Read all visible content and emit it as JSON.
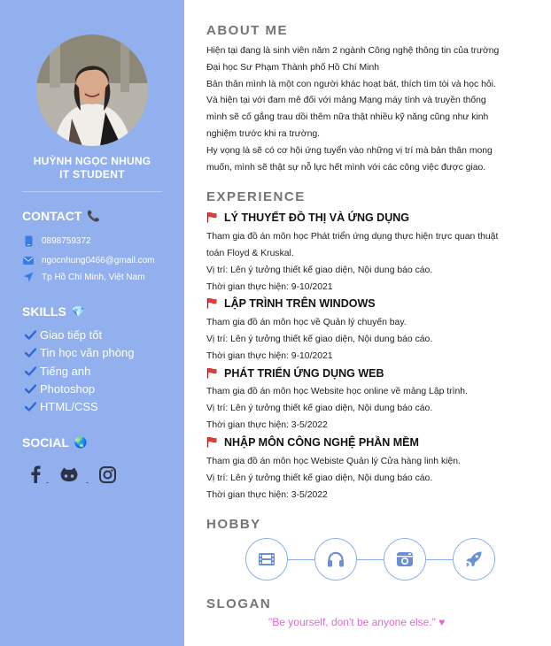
{
  "profile": {
    "name": "HUỲNH NGỌC NHUNG",
    "role": "IT STUDENT"
  },
  "contact": {
    "heading": "CONTACT",
    "heading_emoji": "📞",
    "phone": "0898759372",
    "email": "ngocnhung0466@gmail.com",
    "location": "Tp Hồ Chí Minh, Việt Nam"
  },
  "skills": {
    "heading": "SKILLS",
    "heading_emoji": "💎",
    "items": [
      "Giao tiếp tốt",
      "Tin học văn phòng",
      "Tiếng anh",
      "Photoshop",
      "HTML/CSS"
    ]
  },
  "social": {
    "heading": "SOCIAL",
    "heading_emoji": "🌏",
    "icons": [
      "facebook-icon",
      "github-icon",
      "instagram-icon"
    ]
  },
  "about": {
    "heading": "ABOUT ME",
    "lines": [
      "Hiện tại đang là sinh viên năm 2 ngành Công nghệ thông tin của trường",
      "Đại học Sư Phạm Thành phố Hồ Chí Minh",
      "Bản thân mình là một con người khác hoạt bát, thích tìm tòi và học hỏi.",
      "Và hiện tại với đam mê đối với mảng Mạng máy tính và truyền thống",
      "mình sẽ cố gắng trau dồi thêm nữa thật nhiều kỹ năng cũng như kinh",
      "nghiệm trước khi ra trường.",
      "Hy vọng là sẽ có cơ hội ứng tuyển vào những vị trí mà bản thân mong",
      "muốn, mình sẽ thật sự nỗ lực hết mình với các công việc được giao."
    ]
  },
  "experience": {
    "heading": "EXPERIENCE",
    "items": [
      {
        "title": "LÝ THUYẾT ĐỒ THỊ VÀ ỨNG DỤNG",
        "desc1": "Tham gia đồ án môn học Phát triển ứng dụng thực hiện trực quan thuật",
        "desc2": "toán Floyd & Kruskal.",
        "role": "Vị trí: Lên ý tưởng thiết kế giao diện, Nội dung báo cáo.",
        "time": "Thời gian thực hiện: 9-10/2021"
      },
      {
        "title": "LẬP TRÌNH TRÊN WINDOWS",
        "desc1": "Tham gia đồ án môn học về Quản lý chuyến bay.",
        "desc2": "",
        "role": "Vị trí: Lên ý tưởng thiết kế giao diện, Nội dung báo cáo.",
        "time": "Thời gian thực hiện: 9-10/2021"
      },
      {
        "title": "PHÁT TRIỂN ỨNG DỤNG WEB",
        "desc1": "Tham gia đồ án môn học Website học online về mảng Lập trình.",
        "desc2": "",
        "role": "Vị trí: Lên ý tưởng thiết kế giao diện, Nội dung báo cáo.",
        "time": "Thời gian thực hiện: 3-5/2022"
      },
      {
        "title": "NHẬP MÔN CÔNG NGHỆ PHẦN MỀM",
        "desc1": "Tham gia đồ án môn học Webiste Quản lý Cửa hàng linh kiện.",
        "desc2": "",
        "role": "Vị trí: Lên ý tưởng thiết kế giao diện, Nội dung báo cáo.",
        "time": "Thời gian thực hiện: 3-5/2022"
      }
    ]
  },
  "hobby": {
    "heading": "HOBBY",
    "icons": [
      "film-icon",
      "headphones-icon",
      "camera-icon",
      "rocket-icon"
    ]
  },
  "slogan": {
    "heading": "SLOGAN",
    "text": "\"Be yourself, don't be anyone else.\" ♥"
  },
  "colors": {
    "sidebar": "#92b0ee",
    "section_heading": "#757575",
    "accent_line": "#8ab0ea",
    "slogan": "#e06ad0"
  }
}
